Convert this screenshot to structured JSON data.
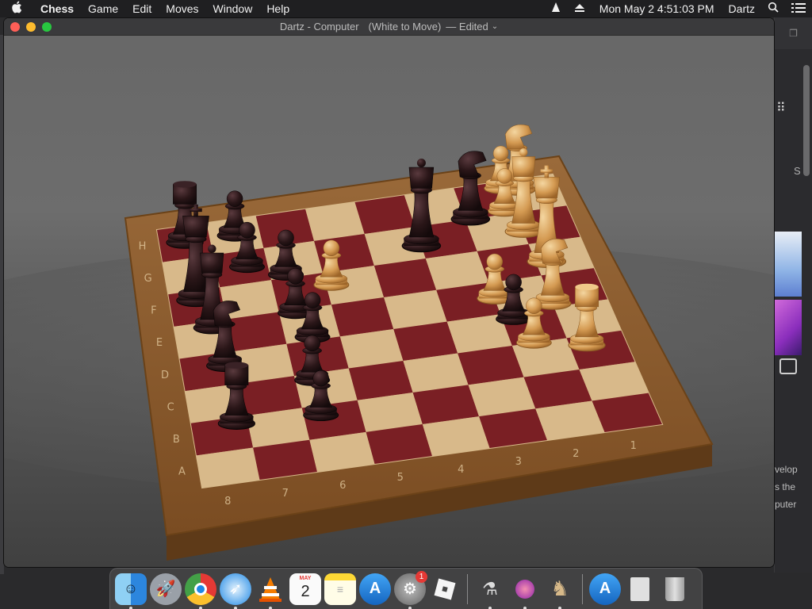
{
  "menubar": {
    "apple_icon": "apple-logo-icon",
    "app_name": "Chess",
    "items": [
      "Game",
      "Edit",
      "Moves",
      "Window",
      "Help"
    ],
    "clock": "Mon May 2  4:51:03 PM",
    "user": "Dartz"
  },
  "window": {
    "title": "Dartz - Computer",
    "status": "(White to Move)",
    "edited": "— Edited"
  },
  "board": {
    "ranks": [
      "H",
      "G",
      "F",
      "E",
      "D",
      "C",
      "B",
      "A"
    ],
    "files": [
      "8",
      "7",
      "6",
      "5",
      "4",
      "3",
      "2",
      "1"
    ],
    "colors": {
      "light_square": "#d8b98a",
      "dark_square": "#7a1f24",
      "frame": "#8a5a2c",
      "white_piece": "#d9a35a",
      "black_piece": "#2a1618"
    }
  },
  "background_window": {
    "side_letter": "S",
    "text_lines": [
      "velop",
      "s the",
      "puter"
    ]
  },
  "dock": {
    "apps": [
      {
        "name": "Finder",
        "icon": "finder-icon"
      },
      {
        "name": "Launchpad",
        "icon": "rocket-icon"
      },
      {
        "name": "Google Chrome",
        "icon": "chrome-icon"
      },
      {
        "name": "Safari",
        "icon": "compass-icon"
      },
      {
        "name": "VLC",
        "icon": "cone-icon"
      },
      {
        "name": "Calendar",
        "icon": "calendar-icon",
        "month": "MAY",
        "day": "2"
      },
      {
        "name": "Notes",
        "icon": "notes-icon"
      },
      {
        "name": "App Store",
        "icon": "app-store-icon"
      },
      {
        "name": "System Preferences",
        "icon": "gear-icon",
        "badge": "1"
      },
      {
        "name": "Roblox",
        "icon": "roblox-icon"
      },
      {
        "name": "Instruments",
        "icon": "instruments-icon"
      },
      {
        "name": "Xcode Tools",
        "icon": "potion-icon"
      },
      {
        "name": "Chess",
        "icon": "chess-knight-icon"
      },
      {
        "name": "App Store Downloads",
        "icon": "app-store-icon"
      },
      {
        "name": "Documents",
        "icon": "document-icon"
      },
      {
        "name": "Trash",
        "icon": "trash-icon"
      }
    ]
  }
}
